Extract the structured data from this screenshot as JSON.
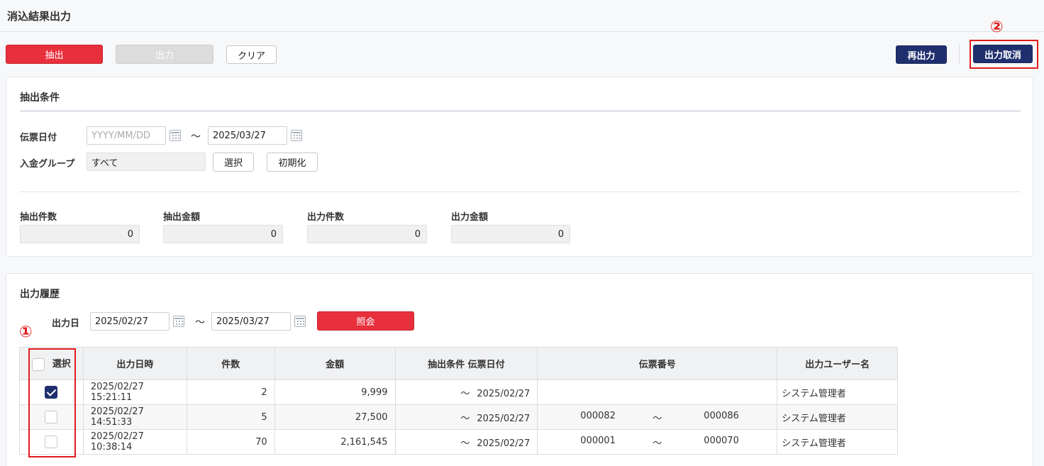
{
  "page": {
    "title": "消込結果出力"
  },
  "toolbar": {
    "extract": "抽出",
    "output": "出力",
    "clear": "クリア",
    "reoutput": "再出力",
    "cancel_output": "出力取消"
  },
  "annotations": {
    "one": "①",
    "two": "②",
    "color": "#e21b1b"
  },
  "conditions": {
    "title": "抽出条件",
    "slip_date_label": "伝票日付",
    "slip_date_from_placeholder": "YYYY/MM/DD",
    "slip_date_from": "",
    "tilde": "～",
    "slip_date_to": "2025/03/27",
    "group_label": "入金グループ",
    "group_value": "すべて",
    "select_button": "選択",
    "reset_button": "初期化"
  },
  "summary": {
    "extract_count_label": "抽出件数",
    "extract_count": "0",
    "extract_amount_label": "抽出金額",
    "extract_amount": "0",
    "output_count_label": "出力件数",
    "output_count": "0",
    "output_amount_label": "出力金額",
    "output_amount": "0"
  },
  "history": {
    "title": "出力履歴",
    "date_label": "出力日",
    "date_from": "2025/02/27",
    "tilde": "～",
    "date_to": "2025/03/27",
    "query_button": "照会",
    "columns": [
      "選択",
      "出力日時",
      "件数",
      "金額",
      "抽出条件 伝票日付",
      "伝票番号",
      "出力ユーザー名"
    ],
    "rows": [
      {
        "checked": true,
        "datetime": "2025/02/27 15:21:11",
        "count": "2",
        "amount": "9,999",
        "tilde": "～",
        "slip_date": "2025/02/27",
        "slip_from": "",
        "slip_tilde": "",
        "slip_to": "",
        "user": "システム管理者"
      },
      {
        "checked": false,
        "datetime": "2025/02/27 14:51:33",
        "count": "5",
        "amount": "27,500",
        "tilde": "～",
        "slip_date": "2025/02/27",
        "slip_from": "000082",
        "slip_tilde": "～",
        "slip_to": "000086",
        "user": "システム管理者"
      },
      {
        "checked": false,
        "datetime": "2025/02/27 10:38:14",
        "count": "70",
        "amount": "2,161,545",
        "tilde": "～",
        "slip_date": "2025/02/27",
        "slip_from": "000001",
        "slip_tilde": "～",
        "slip_to": "000070",
        "user": "システム管理者"
      }
    ]
  },
  "colors": {
    "accent_red": "#e8303c",
    "navy": "#1f2f6e"
  }
}
